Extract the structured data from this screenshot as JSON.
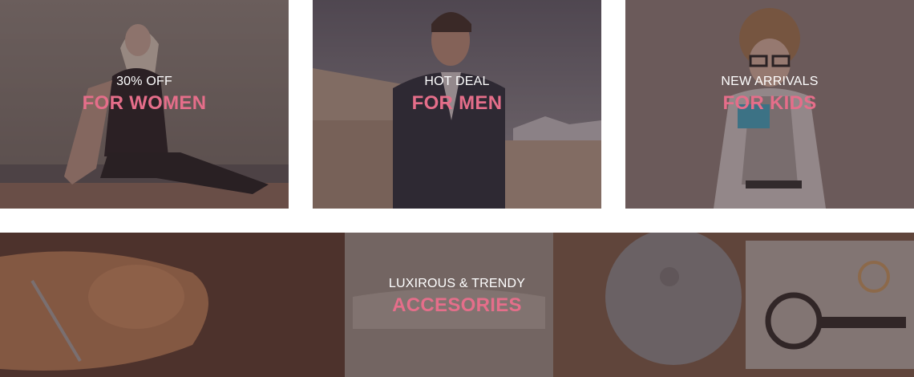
{
  "banners": {
    "women": {
      "kicker": "30% OFF",
      "headline": "FOR WOMEN"
    },
    "men": {
      "kicker": "HOT DEAL",
      "headline": "FOR MEN"
    },
    "kids": {
      "kicker": "NEW ARRIVALS",
      "headline": "FOR KIDS"
    },
    "accessories": {
      "kicker": "LUXIROUS & TRENDY",
      "headline": "ACCESORIES"
    }
  },
  "colors": {
    "accent": "#e56e8a",
    "text": "#ffffff",
    "overlay": "#3c282d"
  }
}
